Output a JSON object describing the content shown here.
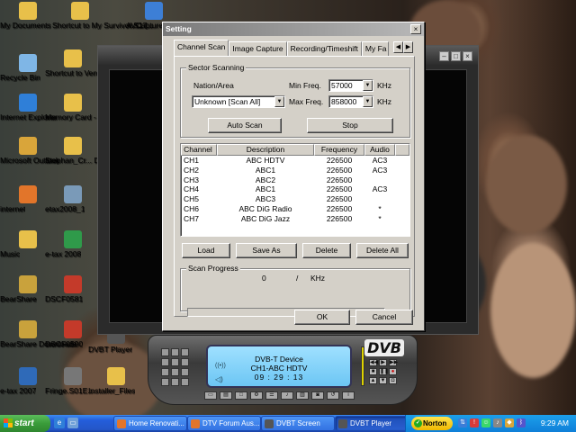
{
  "desktop": {
    "icons": [
      {
        "label": "My Documents",
        "icon": "folder-icon",
        "color": "#e8c04a"
      },
      {
        "label": "Shortcut to My Survivor.S17...",
        "icon": "folder-shortcut-icon",
        "color": "#e8c04a"
      },
      {
        "label": "AVCapture",
        "icon": "app-shortcut-icon",
        "color": "#3d7fd6"
      },
      {
        "label": "Recycle Bin",
        "icon": "recycle-bin-icon",
        "color": "#7fb6e6"
      },
      {
        "label": "Shortcut to Vents STUFF",
        "icon": "folder-shortcut-icon",
        "color": "#e8c04a"
      },
      {
        "label": "Internet Explorer",
        "icon": "internet-explorer-icon",
        "color": "#2f7fd8"
      },
      {
        "label": "Memory Card - Fr",
        "icon": "folder-icon",
        "color": "#e8c04a"
      },
      {
        "label": "Microsoft Outlook",
        "icon": "outlook-icon",
        "color": "#d9a53a"
      },
      {
        "label": "Stephan_Cr... Der",
        "icon": "folder-icon",
        "color": "#e8c04a"
      },
      {
        "label": "internet",
        "icon": "firefox-icon",
        "color": "#e2752a"
      },
      {
        "label": "etax2008_1",
        "icon": "disk-icon",
        "color": "#7a9ab8"
      },
      {
        "label": "Music",
        "icon": "folder-icon",
        "color": "#e8c04a"
      },
      {
        "label": "e-tax 2008",
        "icon": "etax-icon",
        "color": "#2f9a4a"
      },
      {
        "label": "BearShare",
        "icon": "bearshare-icon",
        "color": "#c9a23c"
      },
      {
        "label": "DSCF0581",
        "icon": "pdf-icon",
        "color": "#c43a2a"
      },
      {
        "label": "BearShare Downloads",
        "icon": "bearshare-icon",
        "color": "#c9a23c"
      },
      {
        "label": "DSCF0590",
        "icon": "pdf-icon",
        "color": "#c43a2a"
      },
      {
        "label": "DVBT Player",
        "icon": "dvbt-player-icon",
        "color": "#555555"
      },
      {
        "label": "e-tax 2007",
        "icon": "ato-icon",
        "color": "#2f6ab8"
      },
      {
        "label": "Fringe.S01E...",
        "icon": "video-file-icon",
        "color": "#777777"
      },
      {
        "label": "Installer_Files",
        "icon": "folder-icon",
        "color": "#e8c04a"
      }
    ]
  },
  "dialog": {
    "title": "Setting",
    "close_glyph": "×",
    "tabs": [
      "Channel Scan",
      "Image Capture",
      "Recording/Timeshift",
      "My Fa"
    ],
    "active_tab": "Channel Scan",
    "sector_scanning": {
      "title": "Sector Scanning",
      "nation_label": "Nation/Area",
      "nation_value": "Unknown [Scan All]",
      "min_freq_label": "Min Freq.",
      "min_freq_value": "57000",
      "max_freq_label": "Max Freq.",
      "max_freq_value": "858000",
      "unit": "KHz"
    },
    "buttons": {
      "auto_scan": "Auto Scan",
      "stop": "Stop",
      "load": "Load",
      "save_as": "Save As",
      "delete": "Delete",
      "delete_all": "Delete All",
      "ok": "OK",
      "cancel": "Cancel"
    },
    "channel_list": {
      "columns": [
        "Channel",
        "Description",
        "Frequency",
        "Audio"
      ],
      "rows": [
        {
          "channel": "CH1",
          "description": "ABC HDTV",
          "frequency": "226500",
          "audio": "AC3"
        },
        {
          "channel": "CH2",
          "description": "ABC1",
          "frequency": "226500",
          "audio": "AC3"
        },
        {
          "channel": "CH3",
          "description": "ABC2",
          "frequency": "226500",
          "audio": ""
        },
        {
          "channel": "CH4",
          "description": "ABC1",
          "frequency": "226500",
          "audio": "AC3"
        },
        {
          "channel": "CH5",
          "description": "ABC3",
          "frequency": "226500",
          "audio": ""
        },
        {
          "channel": "CH6",
          "description": "ABC DiG Radio",
          "frequency": "226500",
          "audio": "*"
        },
        {
          "channel": "CH7",
          "description": "ABC DiG Jazz",
          "frequency": "226500",
          "audio": "*"
        }
      ]
    },
    "scan_progress": {
      "title": "Scan Progress",
      "value": "0",
      "separator": "/",
      "unit": "KHz",
      "fraction": 0
    }
  },
  "player": {
    "lcd_line1": "DVB-T Device",
    "lcd_line2": "CH1-ABC HDTV",
    "lcd_line3": "09 : 29 : 13",
    "logo": "DVB",
    "colors": {
      "lcd": "#7fd0f8"
    }
  },
  "taskbar": {
    "start_label": "start",
    "tasks": [
      {
        "label": "Home Renovati...",
        "icon": "firefox-icon",
        "color": "#e2752a",
        "active": false
      },
      {
        "label": "DTV Forum Aus...",
        "icon": "firefox-icon",
        "color": "#e2752a",
        "active": false
      },
      {
        "label": "DVBT Screen",
        "icon": "dvbt-window-icon",
        "color": "#555555",
        "active": false
      },
      {
        "label": "DVBT Player",
        "icon": "dvbt-window-icon",
        "color": "#555555",
        "active": true
      }
    ],
    "norton_label": "Norton",
    "clock": "9:29 AM"
  }
}
